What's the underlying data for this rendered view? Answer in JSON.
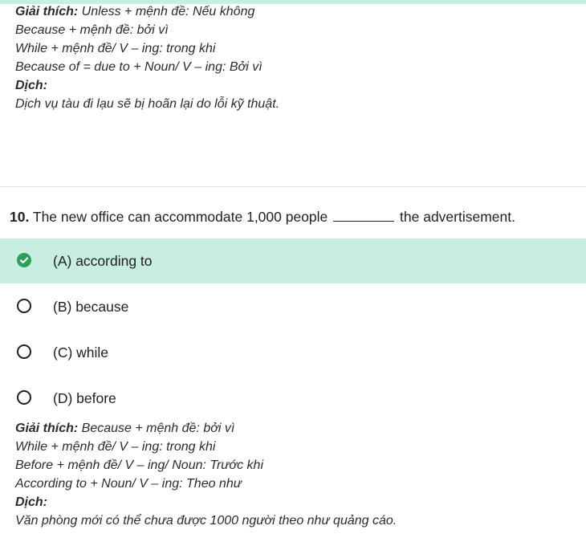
{
  "prev_explanation": {
    "heading": "Giải thích:",
    "first_line": " Unless + mệnh đề: Nếu không",
    "lines": [
      "Because + mệnh đề: bởi vì",
      "While + mệnh đề/ V – ing: trong khi",
      "Because of = due to + Noun/ V – ing: Bởi vì"
    ],
    "translation_heading": "Dịch:",
    "translation": "Dịch vụ tàu đi lạu sẽ bị hoãn lại do lỗi kỹ thuật."
  },
  "question": {
    "number": "10.",
    "text_before": " The new office can accommodate 1,000 people ",
    "text_after": " the advertisement."
  },
  "options": [
    {
      "label": "(A) according to",
      "selected": true
    },
    {
      "label": "(B) because",
      "selected": false
    },
    {
      "label": "(C) while",
      "selected": false
    },
    {
      "label": "(D) before",
      "selected": false
    }
  ],
  "explanation": {
    "heading": "Giải thích:",
    "first_line": " Because + mệnh đề: bởi vì",
    "lines": [
      "While + mệnh đề/ V – ing: trong khi",
      "Before + mệnh đề/ V – ing/ Noun: Trước khi",
      "According to + Noun/ V – ing: Theo như"
    ],
    "translation_heading": "Dịch:",
    "translation": "Văn phòng mới có thể chưa được 1000 người theo như quảng cáo."
  },
  "colors": {
    "selected_bg": "#c8ede1",
    "check_green": "#2e9e5b"
  },
  "icons": {
    "selected": "check-circle-icon",
    "unselected": "radio-empty-icon"
  }
}
